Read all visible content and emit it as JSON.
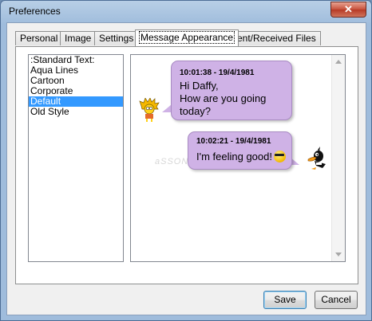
{
  "window": {
    "title": "Preferences",
    "close_glyph": "✕"
  },
  "tabs": [
    {
      "label": "Personal",
      "active": false
    },
    {
      "label": "Image",
      "active": false
    },
    {
      "label": "Settings",
      "active": false
    },
    {
      "label": "Message Appearance",
      "active": true
    },
    {
      "label": "Sent/Received Files",
      "active": false
    }
  ],
  "style_list": {
    "items": [
      ":Standard Text:",
      "Aqua Lines",
      "Cartoon",
      "Corporate",
      "Default",
      "Old Style"
    ],
    "selected": "Default"
  },
  "preview": {
    "messages": [
      {
        "timestamp": "10:01:38 - 19/4/1981",
        "lines": [
          "Hi Daffy,",
          "How are you going",
          "today?"
        ],
        "avatar": "lisa-avatar-icon",
        "bubble_color": "#cfb2e6"
      },
      {
        "timestamp": "10:02:21 - 19/4/1981",
        "lines": [
          "I'm feeling good!"
        ],
        "emoticon": "cool-smiley-icon",
        "avatar": "daffy-duck-avatar-icon",
        "bubble_color": "#cfb2e6"
      }
    ],
    "watermark": "aSSONiNe"
  },
  "buttons": {
    "save": "Save",
    "cancel": "Cancel"
  },
  "colors": {
    "selection": "#3399ff",
    "bubble": "#cfb2e6",
    "default_button_border": "#3c7fb1"
  }
}
